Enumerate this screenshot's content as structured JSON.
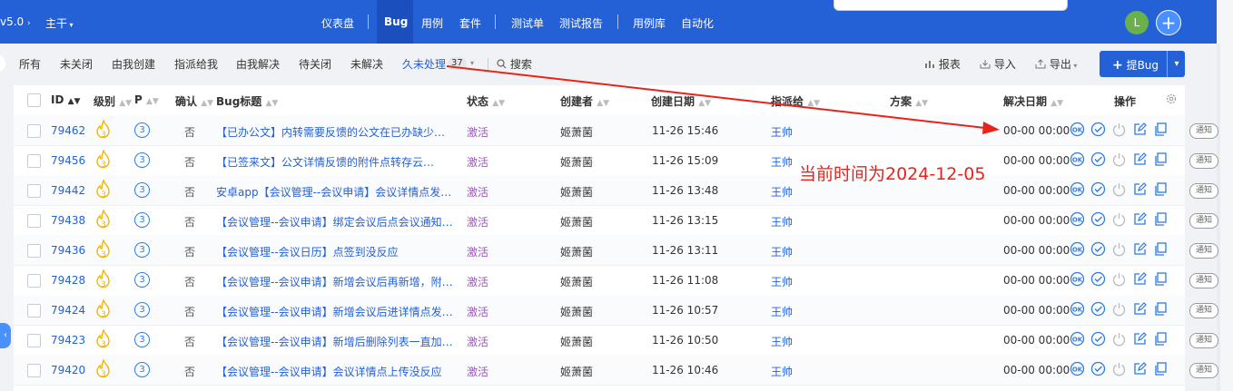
{
  "topbar": {
    "version": "v5.0",
    "branch": "主干",
    "nav": [
      "仪表盘",
      "Bug",
      "用例",
      "套件",
      "测试单",
      "测试报告",
      "用例库",
      "自动化"
    ],
    "avatar_letter": "L"
  },
  "filters": {
    "items": [
      "所有",
      "未关闭",
      "由我创建",
      "指派给我",
      "由我解决",
      "待关闭",
      "未解决",
      "久未处理"
    ],
    "active": "久未处理",
    "active_count": "37",
    "search": "搜索",
    "report": "报表",
    "import": "导入",
    "export": "导出",
    "create_bug": "提Bug"
  },
  "table": {
    "headers": {
      "id": "ID",
      "severity": "级别",
      "priority": "P",
      "confirmed": "确认",
      "title": "Bug标题",
      "status": "状态",
      "creator": "创建者",
      "created": "创建日期",
      "assignee": "指派给",
      "solution": "方案",
      "resolved": "解决日期",
      "actions": "操作"
    },
    "rows": [
      {
        "id": "79462",
        "severity": "3",
        "priority": "3",
        "confirmed": "否",
        "title": "【已办公文】内转需要反馈的公文在已办缺少反…",
        "status": "激活",
        "creator": "姬萧菌",
        "created": "11-26 15:46",
        "assignee": "王帅",
        "resolved": "00-00 00:00",
        "notice": "通知"
      },
      {
        "id": "79456",
        "severity": "3",
        "priority": "3",
        "confirmed": "否",
        "title": "【已签来文】公文详情反馈的附件点转存云…",
        "status": "激活",
        "creator": "姬萧菌",
        "created": "11-26 15:09",
        "assignee": "王帅",
        "resolved": "00-00 00:00",
        "notice": "通知"
      },
      {
        "id": "79442",
        "severity": "3",
        "priority": "3",
        "confirmed": "否",
        "title": "安卓app【会议管理--会议申请】会议详情点发起…",
        "status": "激活",
        "creator": "姬萧菌",
        "created": "11-26 13:48",
        "assignee": "王帅",
        "resolved": "00-00 00:00",
        "notice": "通知"
      },
      {
        "id": "79438",
        "severity": "3",
        "priority": "3",
        "confirmed": "否",
        "title": "【会议管理--会议申请】绑定会议后点会议通知…",
        "status": "激活",
        "creator": "姬萧菌",
        "created": "11-26 13:15",
        "assignee": "王帅",
        "resolved": "00-00 00:00",
        "notice": "通知"
      },
      {
        "id": "79436",
        "severity": "3",
        "priority": "3",
        "confirmed": "否",
        "title": "【会议管理--会议日历】点签到没反应",
        "status": "激活",
        "creator": "姬萧菌",
        "created": "11-26 13:11",
        "assignee": "王帅",
        "resolved": "00-00 00:00",
        "notice": "通知"
      },
      {
        "id": "79428",
        "severity": "3",
        "priority": "3",
        "confirmed": "否",
        "title": "【会议管理--会议申请】新增会议后再新增，附…",
        "status": "激活",
        "creator": "姬萧菌",
        "created": "11-26 11:08",
        "assignee": "王帅",
        "resolved": "00-00 00:00",
        "notice": "通知"
      },
      {
        "id": "79424",
        "severity": "3",
        "priority": "3",
        "confirmed": "否",
        "title": "【会议管理--会议申请】新增会议后进详情点发…",
        "status": "激活",
        "creator": "姬萧菌",
        "created": "11-26 10:57",
        "assignee": "王帅",
        "resolved": "00-00 00:00",
        "notice": "通知"
      },
      {
        "id": "79423",
        "severity": "3",
        "priority": "3",
        "confirmed": "否",
        "title": "【会议管理--会议申请】新增后删除列表一直加…",
        "status": "激活",
        "creator": "姬萧菌",
        "created": "11-26 10:50",
        "assignee": "王帅",
        "resolved": "00-00 00:00",
        "notice": "通知"
      },
      {
        "id": "79420",
        "severity": "3",
        "priority": "3",
        "confirmed": "否",
        "title": "【会议管理--会议申请】会议详情点上传没反应",
        "status": "激活",
        "creator": "姬萧菌",
        "created": "11-26 10:46",
        "assignee": "王帅",
        "resolved": "00-00 00:00",
        "notice": "通知"
      }
    ]
  },
  "annotation": "当前时间为2024-12-05",
  "colors": {
    "brand": "#2461d6",
    "annotation": "#e8231a",
    "status_active": "#9b59b6"
  }
}
